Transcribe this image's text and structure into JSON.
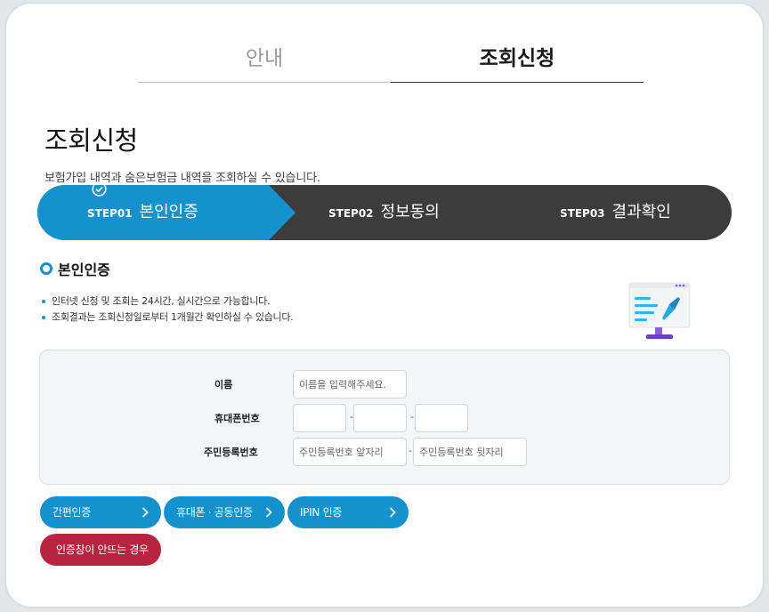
{
  "tabs": {
    "info": "안내",
    "request": "조회신청"
  },
  "page": {
    "title": "조회신청",
    "description": "보험가입 내역과 숨은보험금 내역을 조회하실 수 있습니다."
  },
  "steps": [
    {
      "no": "STEP01",
      "name": "본인인증",
      "active": true
    },
    {
      "no": "STEP02",
      "name": "정보동의",
      "active": false
    },
    {
      "no": "STEP03",
      "name": "결과확인",
      "active": false
    }
  ],
  "section": {
    "title": "본인인증",
    "notes": [
      "인터넷 신청 및 조회는 24시간, 실시간으로 가능합니다.",
      "조회결과는 조회신청일로부터 1개월간 확인하실 수 있습니다."
    ],
    "illustration": "monitor-pen-icon"
  },
  "form": {
    "name_label": "이름",
    "name_placeholder": "이름을 입력해주세요.",
    "phone_label": "휴대폰번호",
    "phone_sep": "-",
    "ssn_label": "주민등록번호",
    "ssn_front_placeholder": "주민등록번호 앞자리",
    "ssn_back_placeholder": "주민등록번호 뒷자리",
    "ssn_sep": "-"
  },
  "buttons": {
    "simple_auth": "간편인증",
    "phone_cert_auth": "휴대폰 · 공동인증",
    "ipin_auth": "IPIN 인증",
    "popup_help": "인증창이 안뜨는 경우"
  },
  "colors": {
    "accent": "#1591cd",
    "dark": "#3c3c3c",
    "danger": "#b8243f",
    "form_bg": "#f4f6f8"
  }
}
